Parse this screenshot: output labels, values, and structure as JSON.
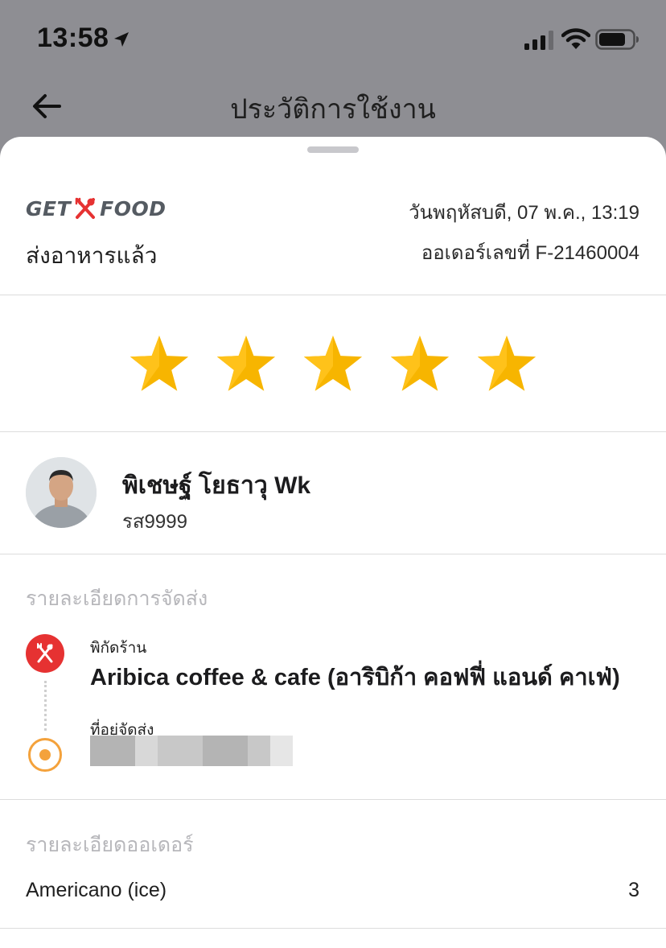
{
  "status_bar": {
    "time": "13:58",
    "icons": [
      "location-arrow-icon",
      "cellular-signal-icon",
      "wifi-icon",
      "battery-icon"
    ]
  },
  "nav": {
    "title": "ประวัติการใช้งาน",
    "back_icon": "arrow-left-icon"
  },
  "order": {
    "brand_left": "GET",
    "brand_right": "FOOD",
    "date": "วันพฤหัสบดี, 07 พ.ค., 13:19",
    "status": "ส่งอาหารแล้ว",
    "number": "ออเดอร์เลขที่ F-21460004"
  },
  "rating": {
    "value": 5,
    "max": 5,
    "star_color": "#f7b500"
  },
  "driver": {
    "name": "พิเชษฐ์ โยธาวุ Wk",
    "plate": "รส9999"
  },
  "delivery": {
    "section_title": "รายละเอียดการจัดส่ง",
    "pickup_label": "พิกัดร้าน",
    "pickup_name": "Aribica coffee & cafe (อาริบิก้า คอฟฟี่ แอนด์ คาเฟ่)",
    "dropoff_label": "ที่อยู่จัดส่ง",
    "pickup_icon_color": "#e63232",
    "dropoff_icon_color": "#f4a23c"
  },
  "order_details": {
    "section_title": "รายละเอียดออเดอร์",
    "items": [
      {
        "name": "Americano (ice)",
        "qty": "3"
      }
    ]
  }
}
